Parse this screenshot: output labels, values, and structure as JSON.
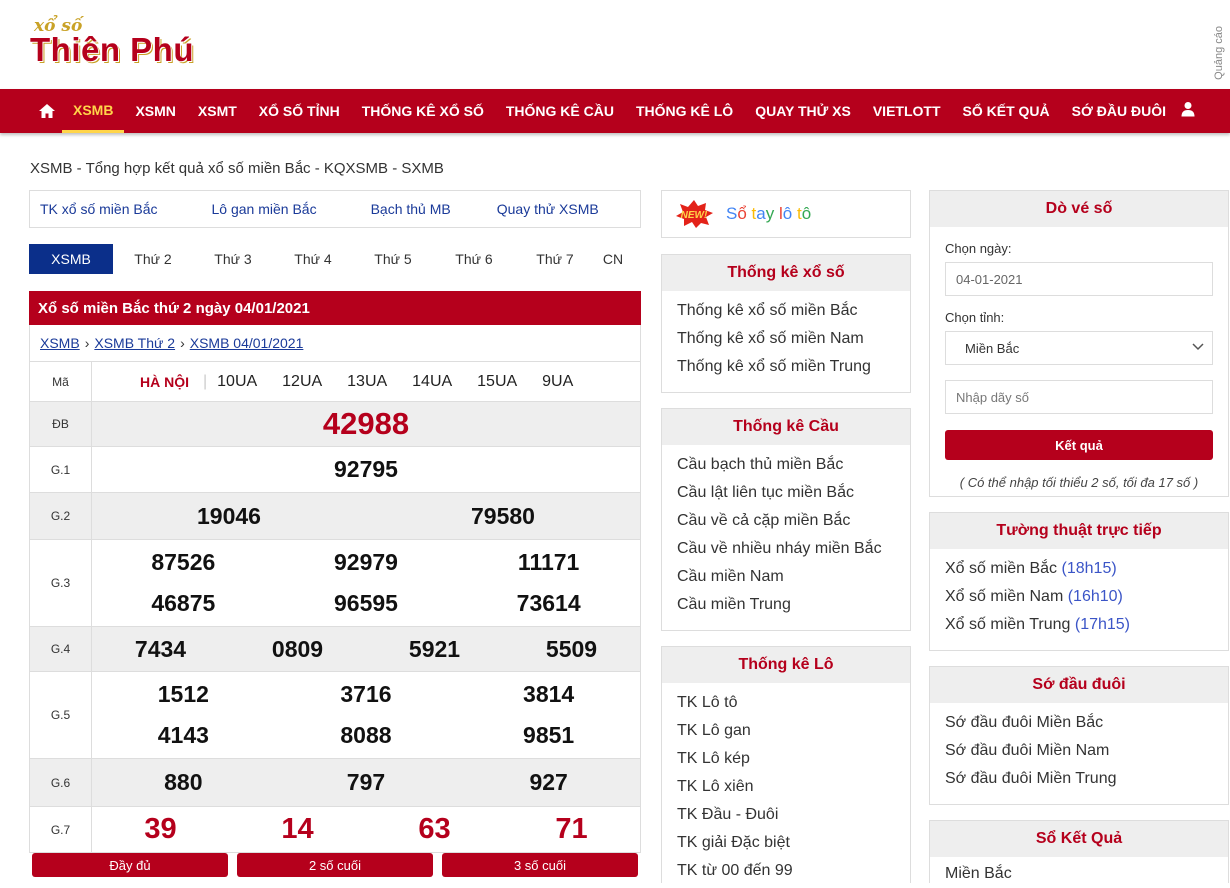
{
  "logo": {
    "top": "xổ số",
    "main": "Thiên Phú"
  },
  "ads_label": "Quảng cáo",
  "colors": {
    "brand": "#b5001c",
    "accent": "#ffd54a",
    "link": "#1a3a99"
  },
  "nav": {
    "items": [
      "XSMB",
      "XSMN",
      "XSMT",
      "XỔ SỐ TỈNH",
      "THỐNG KÊ XỔ SỐ",
      "THỐNG KÊ CẦU",
      "THỐNG KÊ LÔ",
      "QUAY THỬ XS",
      "VIETLOTT",
      "SỔ KẾT QUẢ",
      "SỚ ĐẦU ĐUÔI"
    ],
    "active": "XSMB"
  },
  "page_heading": "XSMB - Tổng hợp kết quả xổ số miền Bắc - KQXSMB - SXMB",
  "quicklinks": [
    "TK xổ số miền Bắc",
    "Lô gan miền Bắc",
    "Bạch thủ MB",
    "Quay thử XSMB"
  ],
  "day_tabs": [
    "XSMB",
    "Thứ 2",
    "Thứ 3",
    "Thứ 4",
    "Thứ 5",
    "Thứ 6",
    "Thứ 7",
    "CN"
  ],
  "result": {
    "title": "Xổ số miền Bắc thứ 2 ngày 04/01/2021",
    "breadcrumb": [
      "XSMB",
      "XSMB Thứ 2",
      "XSMB 04/01/2021"
    ],
    "code_label": "Mã",
    "province": "HÀ NỘI",
    "codes": [
      "10UA",
      "12UA",
      "13UA",
      "14UA",
      "15UA",
      "9UA"
    ],
    "prizes": [
      {
        "label": "ĐB",
        "numbers": [
          "42988"
        ]
      },
      {
        "label": "G.1",
        "numbers": [
          "92795"
        ]
      },
      {
        "label": "G.2",
        "numbers": [
          "19046",
          "79580"
        ]
      },
      {
        "label": "G.3",
        "numbers": [
          "87526",
          "92979",
          "11171",
          "46875",
          "96595",
          "73614"
        ]
      },
      {
        "label": "G.4",
        "numbers": [
          "7434",
          "0809",
          "5921",
          "5509"
        ]
      },
      {
        "label": "G.5",
        "numbers": [
          "1512",
          "3716",
          "3814",
          "4143",
          "8088",
          "9851"
        ]
      },
      {
        "label": "G.6",
        "numbers": [
          "880",
          "797",
          "927"
        ]
      },
      {
        "label": "G.7",
        "numbers": [
          "39",
          "14",
          "63",
          "71"
        ]
      }
    ],
    "buttons": [
      "Đầy đủ",
      "2 số cuối",
      "3 số cuối"
    ]
  },
  "sotay": {
    "letters": [
      "S",
      "ổ",
      " ",
      "t",
      "a",
      "y",
      " ",
      "l",
      "ô",
      " ",
      "t",
      "ô"
    ],
    "colors": [
      "#4285f4",
      "#ea4335",
      "#fff",
      "#fbbc05",
      "#4285f4",
      "#34a853",
      "#fff",
      "#ea4335",
      "#4285f4",
      "#fff",
      "#fbbc05",
      "#34a853"
    ]
  },
  "tk_xoso": {
    "title": "Thống kê xổ số",
    "items": [
      "Thống kê xổ số miền Bắc",
      "Thống kê xổ số miền Nam",
      "Thống kê xổ số miền Trung"
    ]
  },
  "tk_cau": {
    "title": "Thống kê Cầu",
    "items": [
      "Cầu bạch thủ miền Bắc",
      "Cầu lật liên tục miền Bắc",
      "Cầu về cả cặp miền Bắc",
      "Cầu về nhiều nháy miền Bắc",
      "Cầu miền Nam",
      "Cầu miền Trung"
    ]
  },
  "tk_lo": {
    "title": "Thống kê Lô",
    "items": [
      "TK Lô tô",
      "TK Lô gan",
      "TK Lô kép",
      "TK Lô xiên",
      "TK Đầu - Đuôi",
      "TK giải Đặc biệt",
      "TK từ 00 đến 99"
    ]
  },
  "dove": {
    "title": "Dò vé số",
    "date_label": "Chọn ngày:",
    "date_value": "04-01-2021",
    "province_label": "Chọn tỉnh:",
    "province_value": "Miền Bắc",
    "number_placeholder": "Nhập dãy số",
    "submit": "Kết quả",
    "note": "( Có thể nhập tối thiểu 2 số, tối đa 17 số )"
  },
  "live": {
    "title": "Tường thuật trực tiếp",
    "items": [
      {
        "name": "Xổ số miền Bắc",
        "time": "(18h15)"
      },
      {
        "name": "Xổ số miền Nam",
        "time": "(16h10)"
      },
      {
        "name": "Xổ số miền Trung",
        "time": "(17h15)"
      }
    ]
  },
  "sodau": {
    "title": "Sớ đầu đuôi",
    "items": [
      "Sớ đầu đuôi Miền Bắc",
      "Sớ đầu đuôi Miền Nam",
      "Sớ đầu đuôi Miền Trung"
    ]
  },
  "soketqua": {
    "title": "Sổ Kết Quả",
    "items": [
      "Miền Bắc"
    ]
  }
}
